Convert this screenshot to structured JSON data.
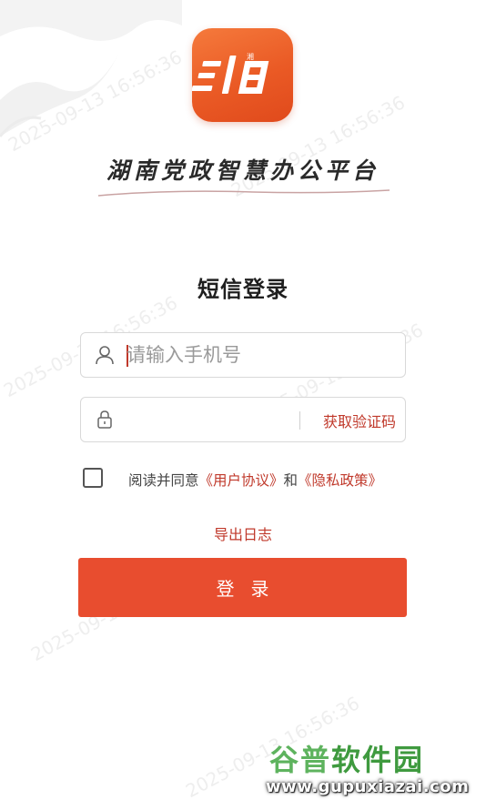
{
  "app": {
    "logo_name": "xiang-logo",
    "title": "湖南党政智慧办公平台"
  },
  "login": {
    "heading": "短信登录",
    "phone_placeholder": "请输入手机号",
    "phone_value": "",
    "code_value": "",
    "get_code_label": "获取验证码",
    "agree_prefix": "阅读并同意",
    "user_agreement": "《用户协议》",
    "agree_and": "和",
    "privacy_policy": "《隐私政策》",
    "agreed": false,
    "export_log_label": "导出日志",
    "login_label": "登录"
  },
  "watermark": {
    "brand_cn_1": "谷普",
    "brand_cn_2": "软件园",
    "brand_url": "www.gupuxiazai.com",
    "stamp": "2025-09-13 16:56:36"
  },
  "colors": {
    "accent": "#e84d2f",
    "link": "#c0392b"
  },
  "icons": {
    "phone_field": "user-icon",
    "code_field": "lock-icon"
  }
}
